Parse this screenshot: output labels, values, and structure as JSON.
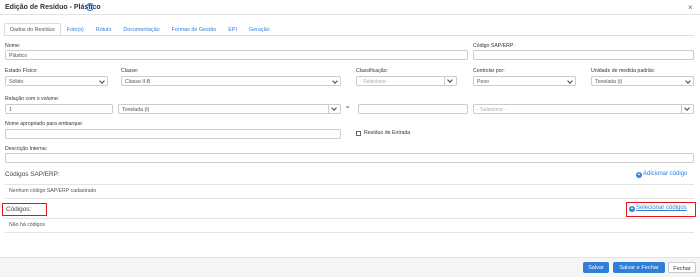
{
  "window": {
    "title": "Edição de Resíduo - Plástico",
    "close": "×"
  },
  "tabs": [
    {
      "label": "Dados do Resíduo"
    },
    {
      "label": "Foto(s)"
    },
    {
      "label": "Rótulo"
    },
    {
      "label": "Documentação"
    },
    {
      "label": "Formas de Gestão"
    },
    {
      "label": "EPI"
    },
    {
      "label": "Geração"
    }
  ],
  "form": {
    "nome": {
      "label": "Nome:",
      "value": "Plástico"
    },
    "codigo_sap": {
      "label": "Código SAP/ERP:",
      "value": ""
    },
    "estado_fisico": {
      "label": "Estado Físico:",
      "value": "Sólido"
    },
    "classe": {
      "label": "Classe:",
      "value": "Classe II-B"
    },
    "classificacao": {
      "label": "Classificação:",
      "placeholder": "- Selecione -"
    },
    "controlar_por": {
      "label": "Controlar por:",
      "value": "Peso"
    },
    "unidade_medida": {
      "label": "Unidade de medida padrão:",
      "value": "Tonelada (t)"
    },
    "relacao_volume": {
      "label": "Relação com o volume:",
      "quantity": "1",
      "unit": "Tonelada (t)",
      "equals": "=",
      "value": "",
      "placeholder": "- Selecione -"
    },
    "nome_embarque": {
      "label": "Nome apropriado para embarque:",
      "value": ""
    },
    "residuo_entrada": {
      "label": "Resíduo de Entrada"
    },
    "descricao_interna": {
      "label": "Descrição Interna:",
      "value": ""
    }
  },
  "codigos_sap": {
    "title": "Códigos SAP/ERP:",
    "add_label": "Adicionar código",
    "empty_text": "Nenhum código SAP/ERP cadastrado"
  },
  "codigos": {
    "title": "Códigos:",
    "select_label": "Selecionar códigos",
    "empty_text": "Não há códigos"
  },
  "footer": {
    "save": "Salvar",
    "save_close": "Salvar e Fechar",
    "close": "Fechar"
  },
  "colors": {
    "accent": "#2f7ed8",
    "highlight": "#e3161b"
  }
}
